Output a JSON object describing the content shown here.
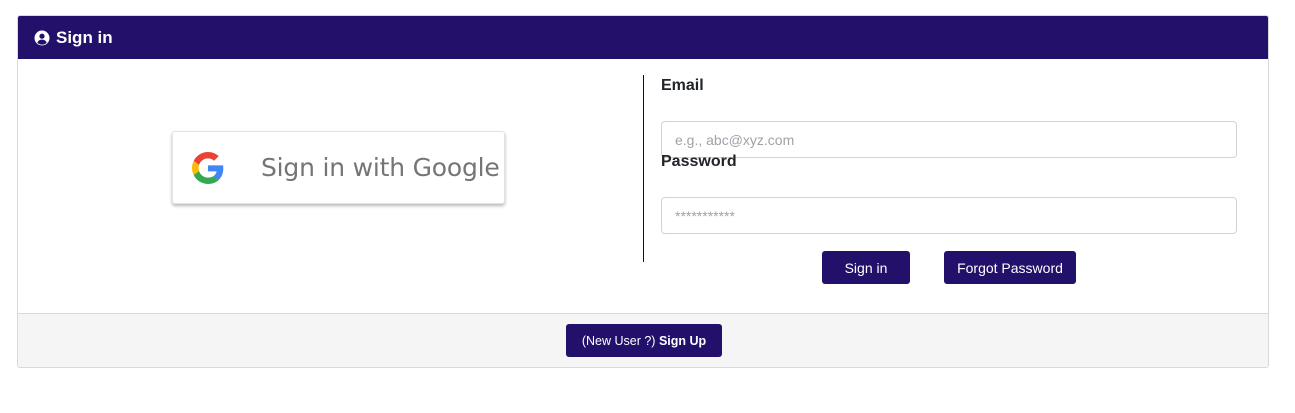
{
  "header": {
    "title": "Sign in",
    "icon": "user-circle-icon"
  },
  "google": {
    "label": "Sign in with Google",
    "icon": "google-g-icon"
  },
  "form": {
    "email_label": "Email",
    "email_placeholder": "e.g., abc@xyz.com",
    "email_value": "",
    "password_label": "Password",
    "password_placeholder": "***********",
    "password_value": "",
    "signin_label": "Sign in",
    "forgot_label": "Forgot Password"
  },
  "footer": {
    "signup_prefix": "(New User ?)",
    "signup_label": "Sign Up"
  },
  "colors": {
    "brand": "#22106b",
    "footer_bg": "#f5f5f5"
  }
}
